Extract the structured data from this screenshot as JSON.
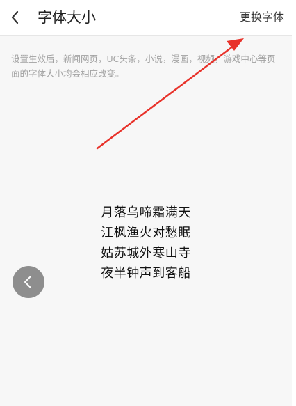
{
  "header": {
    "title": "字体大小",
    "change_font_label": "更换字体",
    "back_icon": "chevron-left-icon"
  },
  "notice": "设置生效后，新闻网页，UC头条，小说，漫画，视频，游戏中心等页面的字体大小均会相应改变。",
  "poem": {
    "lines": [
      "月落乌啼霜满天",
      "江枫渔火对愁眠",
      "姑苏城外寒山寺",
      "夜半钟声到客船"
    ]
  },
  "prev_button": {
    "icon": "chevron-left-icon"
  },
  "annotation": {
    "color": "#e8322a"
  }
}
